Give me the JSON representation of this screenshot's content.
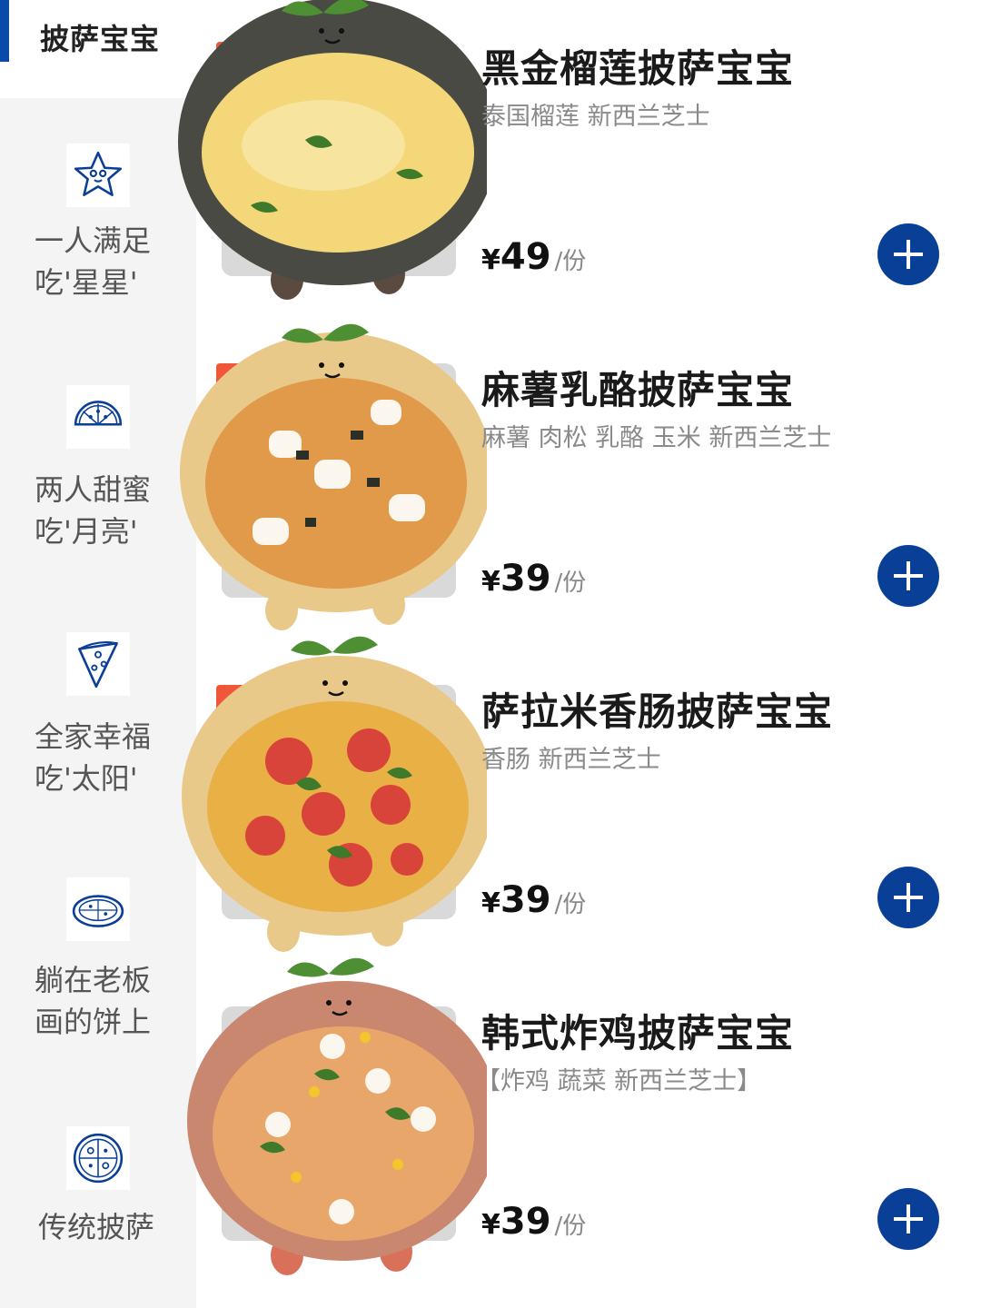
{
  "sidebar": {
    "active_label": "披萨宝宝",
    "categories": [
      {
        "line1": "一人满足",
        "line2": "吃'星星'",
        "icon": "star-icon"
      },
      {
        "line1": "两人甜蜜",
        "line2": "吃'月亮'",
        "icon": "half-pizza-icon"
      },
      {
        "line1": "全家幸福",
        "line2": "吃'太阳'",
        "icon": "pizza-slice-icon"
      },
      {
        "line1": "躺在老板",
        "line2": "画的饼上",
        "icon": "pizza-plate-icon"
      },
      {
        "line1": "传统披萨",
        "line2": "",
        "icon": "whole-pizza-icon"
      }
    ]
  },
  "products": [
    {
      "name": "黑金榴莲披萨宝宝",
      "desc": "泰国榴莲 新西兰芝士",
      "currency": "¥",
      "price": "49",
      "unit": "/份",
      "crust_color": "#4a4a44",
      "topping_color": "#f3d779"
    },
    {
      "name": "麻薯乳酪披萨宝宝",
      "desc": "麻薯 肉松 乳酪 玉米 新西兰芝士",
      "currency": "¥",
      "price": "39",
      "unit": "/份",
      "crust_color": "#e8c98a",
      "topping_color": "#e09a4a"
    },
    {
      "name": "萨拉米香肠披萨宝宝",
      "desc": "香肠 新西兰芝士",
      "currency": "¥",
      "price": "39",
      "unit": "/份",
      "crust_color": "#e8c98a",
      "topping_color": "#e8b045"
    },
    {
      "name": "韩式炸鸡披萨宝宝",
      "desc": "【炸鸡 蔬菜 新西兰芝士】",
      "currency": "¥",
      "price": "39",
      "unit": "/份",
      "crust_color": "#c98770",
      "topping_color": "#e9a66a"
    }
  ],
  "colors": {
    "accent": "#0a3f97",
    "sidebar_bg": "#f4f4f4",
    "tag": "#f0563a"
  }
}
